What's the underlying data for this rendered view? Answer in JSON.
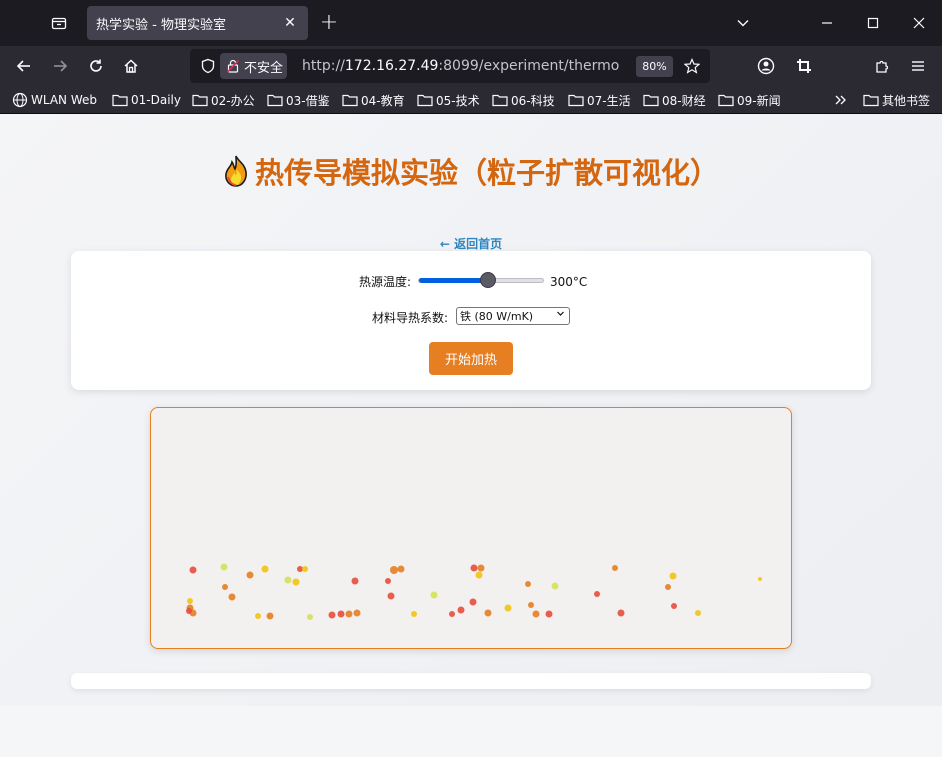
{
  "browser": {
    "tab_title": "热学实验 - 物理实验室",
    "url_security_label": "不安全",
    "url_prefix": "http://",
    "url_host": "172.16.27.49",
    "url_rest": ":8099/experiment/thermo",
    "zoom": "80%",
    "bookmarks": [
      "WLAN Web",
      "01-Daily",
      "02-办公",
      "03-借鉴",
      "04-教育",
      "05-技术",
      "06-科技",
      "07-生活",
      "08-财经",
      "09-新闻",
      "其他书签"
    ]
  },
  "page": {
    "title": "热传导模拟实验（粒子扩散可视化）",
    "back_link": "← 返回首页",
    "temperature": {
      "label": "热源温度:",
      "value_text": "300°C",
      "level": 0.55
    },
    "material": {
      "label": "材料导热系数:",
      "selected": "铁 (80 W/mK)"
    },
    "start_button": "开始加热",
    "particle_colors": [
      "#e74c3c",
      "#e67e22",
      "#f1c40f",
      "#d4e157"
    ]
  }
}
